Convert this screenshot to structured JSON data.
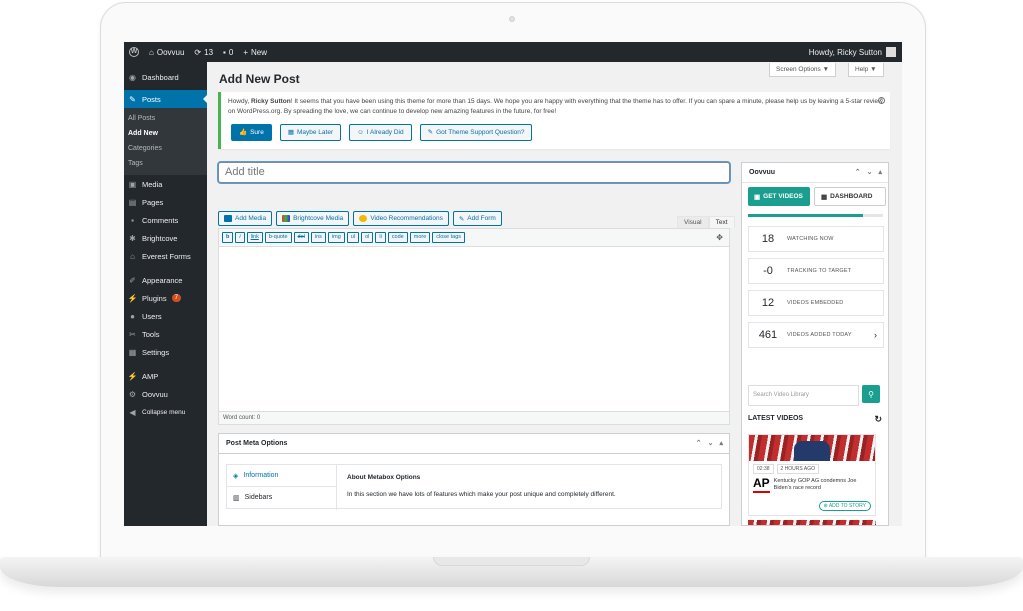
{
  "adminbar": {
    "site_name": "Oovvuu",
    "updates_count": "13",
    "comments_count": "0",
    "new_label": "New",
    "howdy": "Howdy, Ricky Sutton"
  },
  "sidebar": {
    "items": [
      {
        "label": "Dashboard",
        "icon": "dashboard-icon"
      },
      {
        "label": "Posts",
        "icon": "pin-icon"
      },
      {
        "label": "Media",
        "icon": "media-icon"
      },
      {
        "label": "Pages",
        "icon": "pages-icon"
      },
      {
        "label": "Comments",
        "icon": "comment-icon"
      },
      {
        "label": "Brightcove",
        "icon": "brightcove-icon"
      },
      {
        "label": "Everest Forms",
        "icon": "forms-icon"
      },
      {
        "label": "Appearance",
        "icon": "brush-icon"
      },
      {
        "label": "Plugins",
        "icon": "plugin-icon",
        "badge": "7"
      },
      {
        "label": "Users",
        "icon": "user-icon"
      },
      {
        "label": "Tools",
        "icon": "wrench-icon"
      },
      {
        "label": "Settings",
        "icon": "settings-icon"
      },
      {
        "label": "AMP",
        "icon": "amp-icon"
      },
      {
        "label": "Oovvuu",
        "icon": "gear-icon"
      },
      {
        "label": "Collapse menu",
        "icon": "collapse-icon"
      }
    ],
    "posts_submenu": [
      "All Posts",
      "Add New",
      "Categories",
      "Tags"
    ]
  },
  "header": {
    "title": "Add New Post",
    "screen_options": "Screen Options ▼",
    "help": "Help ▼"
  },
  "notice": {
    "text_before": "Howdy, ",
    "name": "Ricky Sutton",
    "text_after": "! It seems that you have been using this theme for more than 15 days. We hope you are happy with everything that the theme has to offer. If you can spare a minute, please help us by leaving a 5-star review on WordPress.org. By spreading the love, we can continue to develop new amazing features in the future, for free!",
    "buttons": [
      "Sure",
      "Maybe Later",
      "I Already Did",
      "Got Theme Support Question?"
    ]
  },
  "editor": {
    "title_placeholder": "Add title",
    "media_buttons": [
      "Add Media",
      "Brightcove Media",
      "Video Recommendations",
      "Add Form"
    ],
    "tabs": [
      "Visual",
      "Text"
    ],
    "quicktags": [
      "b",
      "i",
      "link",
      "b-quote",
      "del",
      "ins",
      "img",
      "ul",
      "ol",
      "li",
      "code",
      "more",
      "close tags"
    ],
    "word_count": "Word count: 0"
  },
  "metabox": {
    "title": "Post Meta Options",
    "tabs": [
      "Information",
      "Sidebars"
    ],
    "content_title": "About Metabox Options",
    "content_text": "In this section we have lots of features which make your post unique and completely different."
  },
  "widget": {
    "title": "Oovvuu",
    "get_videos": "GET VIDEOS",
    "dashboard": "DASHBOARD",
    "progress": 0.85,
    "stats": [
      {
        "num": "18",
        "label": "WATCHING NOW"
      },
      {
        "num": "-0",
        "label": "TRACKING TO TARGET"
      },
      {
        "num": "12",
        "label": "VIDEOS EMBEDDED"
      },
      {
        "num": "461",
        "label": "VIDEOS ADDED TODAY"
      }
    ],
    "search_placeholder": "Search Video Library",
    "latest_title": "LATEST VIDEOS",
    "video": {
      "duration": "02:38",
      "age": "2 HOURS AGO",
      "source": "AP",
      "title": "Kentucky GOP AG condemns Joe Biden's race record",
      "add_label": "ADD TO STORY"
    }
  },
  "colors": {
    "admin_dark": "#23282d",
    "wp_blue": "#0073aa",
    "accent_green": "#1a9e8f",
    "notice_green": "#46b450"
  }
}
